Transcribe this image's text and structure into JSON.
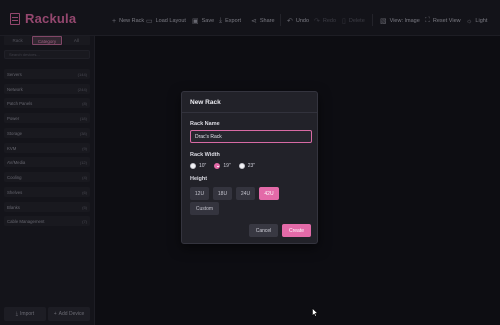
{
  "app": {
    "title": "Rackula"
  },
  "toolbar": {
    "new_rack": "New Rack",
    "load_layout": "Load Layout",
    "save": "Save",
    "export": "Export",
    "share": "Share",
    "undo": "Undo",
    "redo": "Redo",
    "delete": "Delete",
    "view_image": "View: Image",
    "reset_view": "Reset View",
    "light": "Light"
  },
  "sidebar": {
    "tabs": [
      "Rack",
      "Category",
      "All"
    ],
    "active_tab": "Category",
    "search_placeholder": "Search devices...",
    "categories": [
      {
        "label": "Servers",
        "count": "(144)"
      },
      {
        "label": "Network",
        "count": "(244)"
      },
      {
        "label": "Patch Panels",
        "count": "(8)"
      },
      {
        "label": "Power",
        "count": "(18)"
      },
      {
        "label": "Storage",
        "count": "(38)"
      },
      {
        "label": "KVM",
        "count": "(9)"
      },
      {
        "label": "AV/Media",
        "count": "(12)"
      },
      {
        "label": "Cooling",
        "count": "(4)"
      },
      {
        "label": "Shelves",
        "count": "(6)"
      },
      {
        "label": "Blanks",
        "count": "(5)"
      },
      {
        "label": "Cable Management",
        "count": "(7)"
      }
    ],
    "import_label": "Import",
    "add_device_label": "Add Device"
  },
  "modal": {
    "title": "New Rack",
    "rack_name_label": "Rack Name",
    "rack_name_value": "Drac's Rack",
    "rack_width_label": "Rack Width",
    "widths": [
      "10\"",
      "19\"",
      "23\""
    ],
    "selected_width": "19\"",
    "height_label": "Height",
    "heights": [
      "12U",
      "18U",
      "24U",
      "42U"
    ],
    "selected_height": "42U",
    "custom_label": "Custom",
    "cancel_label": "Cancel",
    "create_label": "Create"
  },
  "colors": {
    "accent": "#e36aa8",
    "background": "#18181e",
    "modal_bg": "#222229"
  }
}
